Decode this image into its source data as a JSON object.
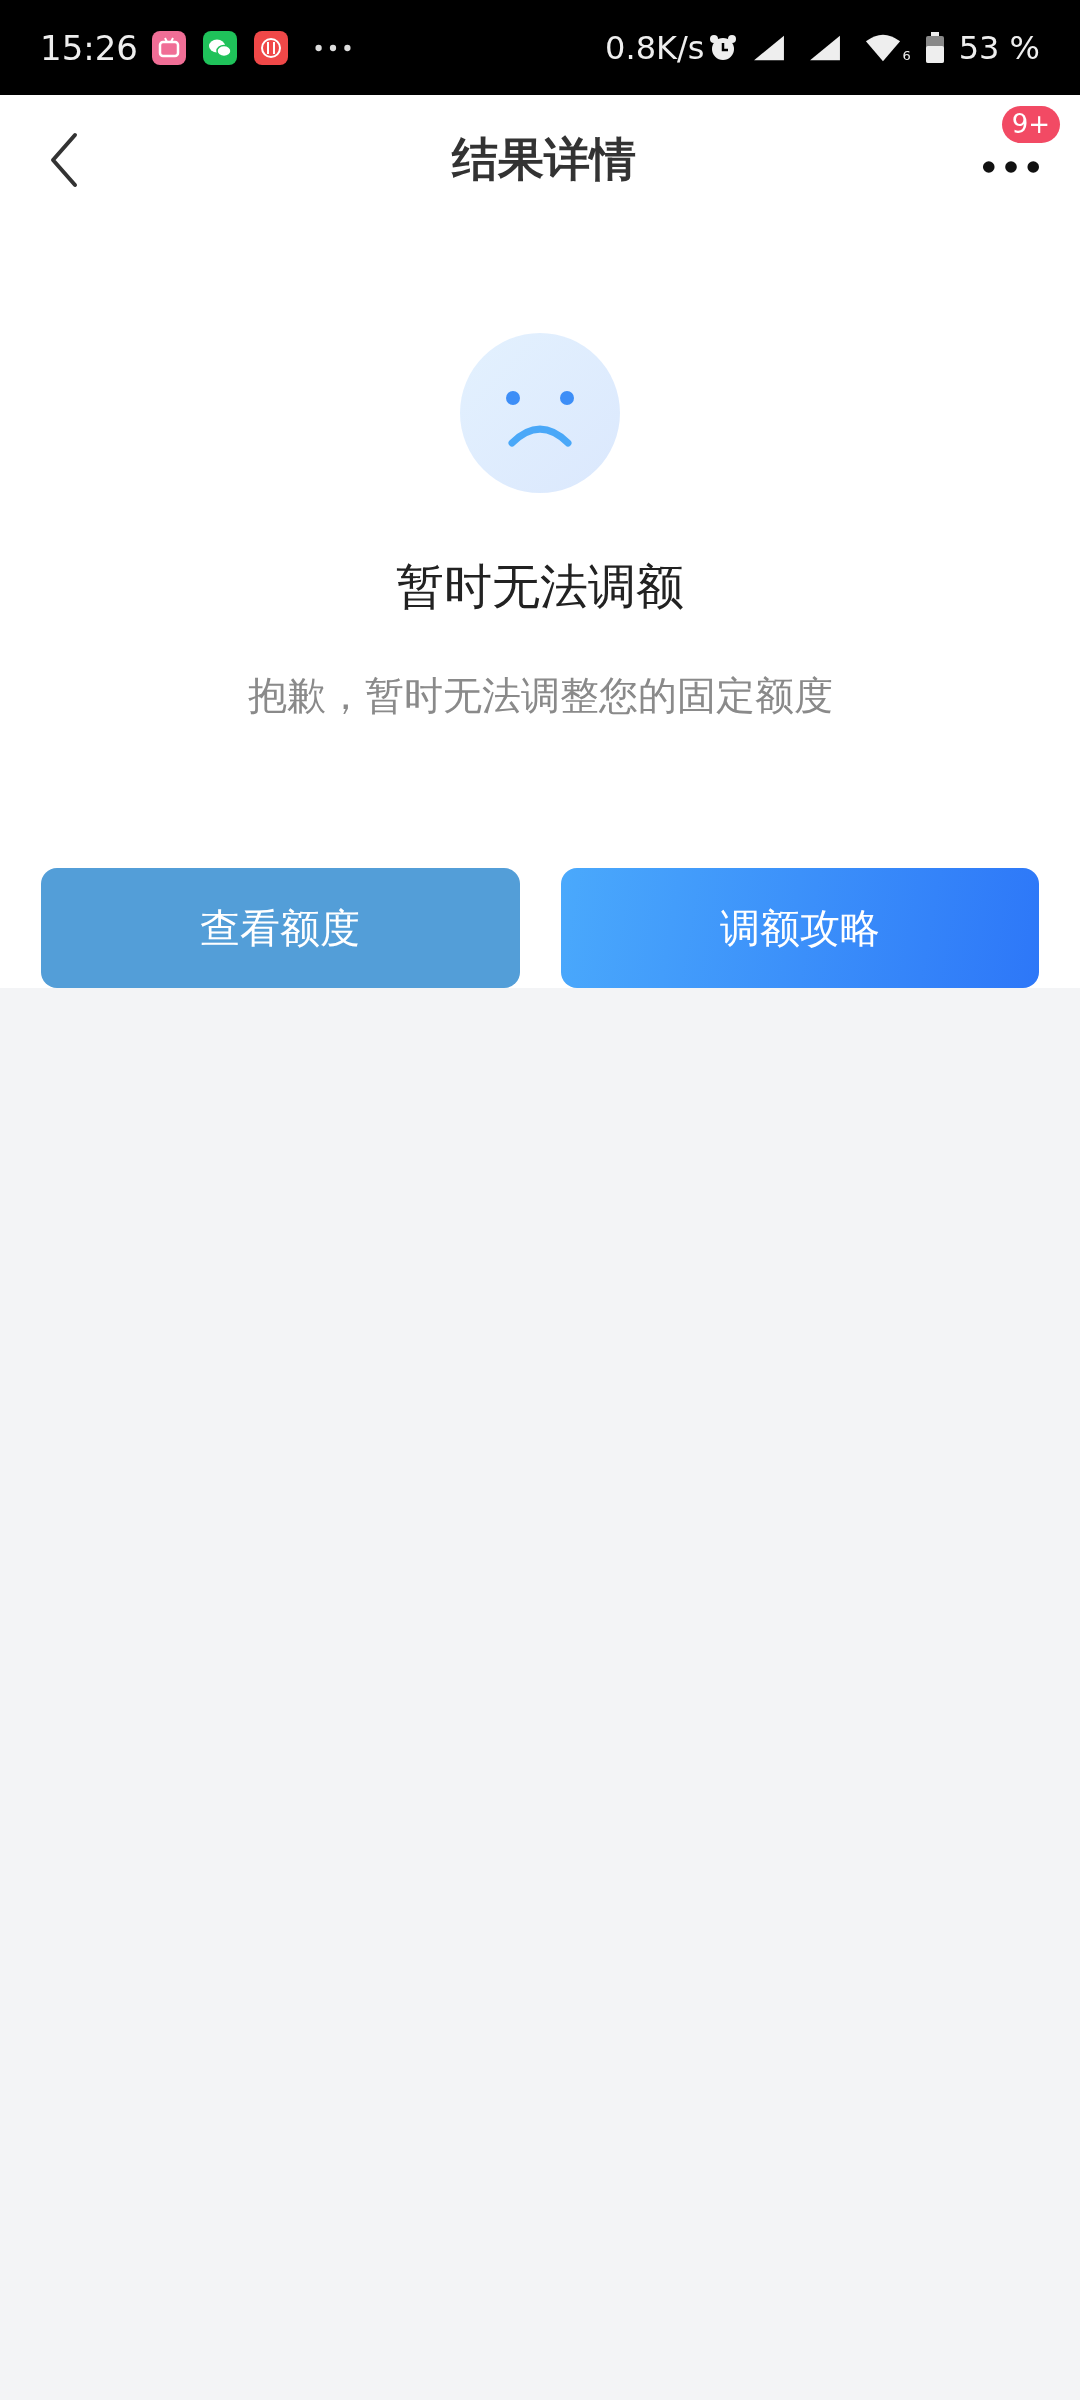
{
  "status_bar": {
    "time": "15:26",
    "network_speed": "0.8K/s",
    "wifi_label": "6",
    "battery": "53 %"
  },
  "nav": {
    "title": "结果详情",
    "badge": "9+"
  },
  "result": {
    "title": "暂时无法调额",
    "message": "抱歉，暂时无法调整您的固定额度"
  },
  "buttons": [
    {
      "label": "查看额度",
      "kind": "secondary"
    },
    {
      "label": "调额攻略",
      "kind": "primary"
    }
  ]
}
